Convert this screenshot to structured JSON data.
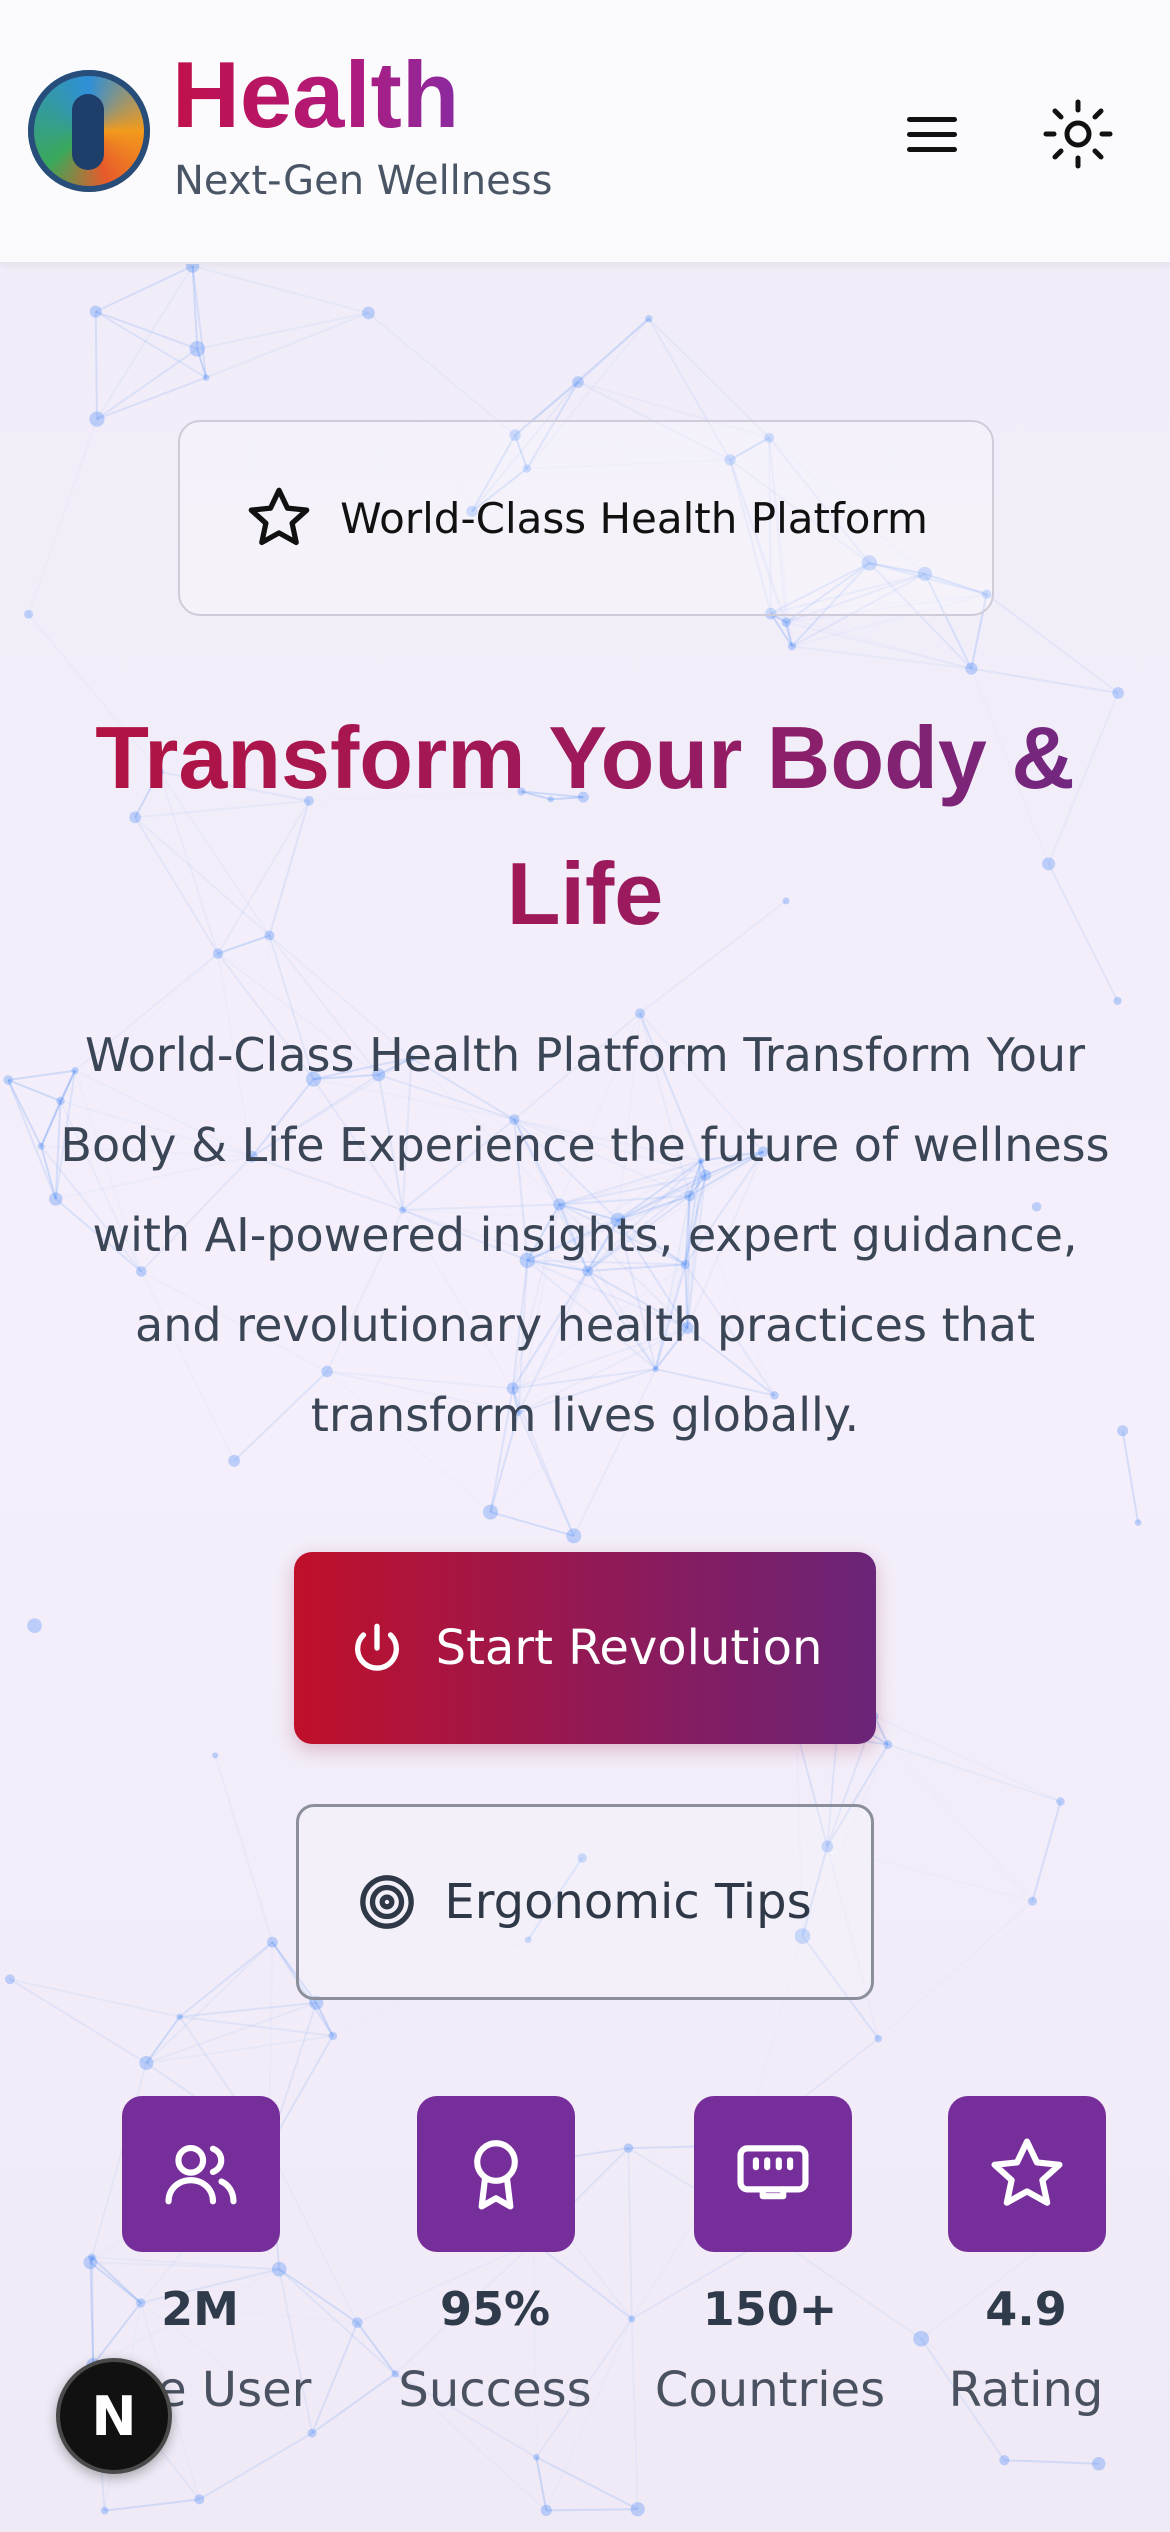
{
  "header": {
    "brand_title": "Health",
    "brand_subtitle": "Next-Gen Wellness",
    "menu_icon": "hamburger-menu-icon",
    "theme_icon": "sun-icon"
  },
  "hero": {
    "badge_text": "World-Class Health Platform",
    "badge_icon": "star-icon",
    "title": "Transform Your Body & Life",
    "description": "World-Class Health Platform Transform Your Body & Life Experience the future of wellness with AI-powered insights, expert guidance, and revolutionary health practices that transform lives globally.",
    "primary_button": "Start Revolution",
    "primary_icon": "power-icon",
    "secondary_button": "Ergonomic Tips",
    "secondary_icon": "target-icon"
  },
  "stats": [
    {
      "value": "2M",
      "label": "Live User",
      "icon": "users-icon"
    },
    {
      "value": "95%",
      "label": "Success",
      "icon": "award-icon"
    },
    {
      "value": "150+",
      "label": "Countries",
      "icon": "network-icon"
    },
    {
      "value": "4.9",
      "label": "Rating",
      "icon": "star-icon"
    }
  ],
  "floating_badge": "N",
  "colors": {
    "brand_pink": "#c0104a",
    "brand_purple": "#762e9a",
    "network_blue": "#3b82f6"
  }
}
